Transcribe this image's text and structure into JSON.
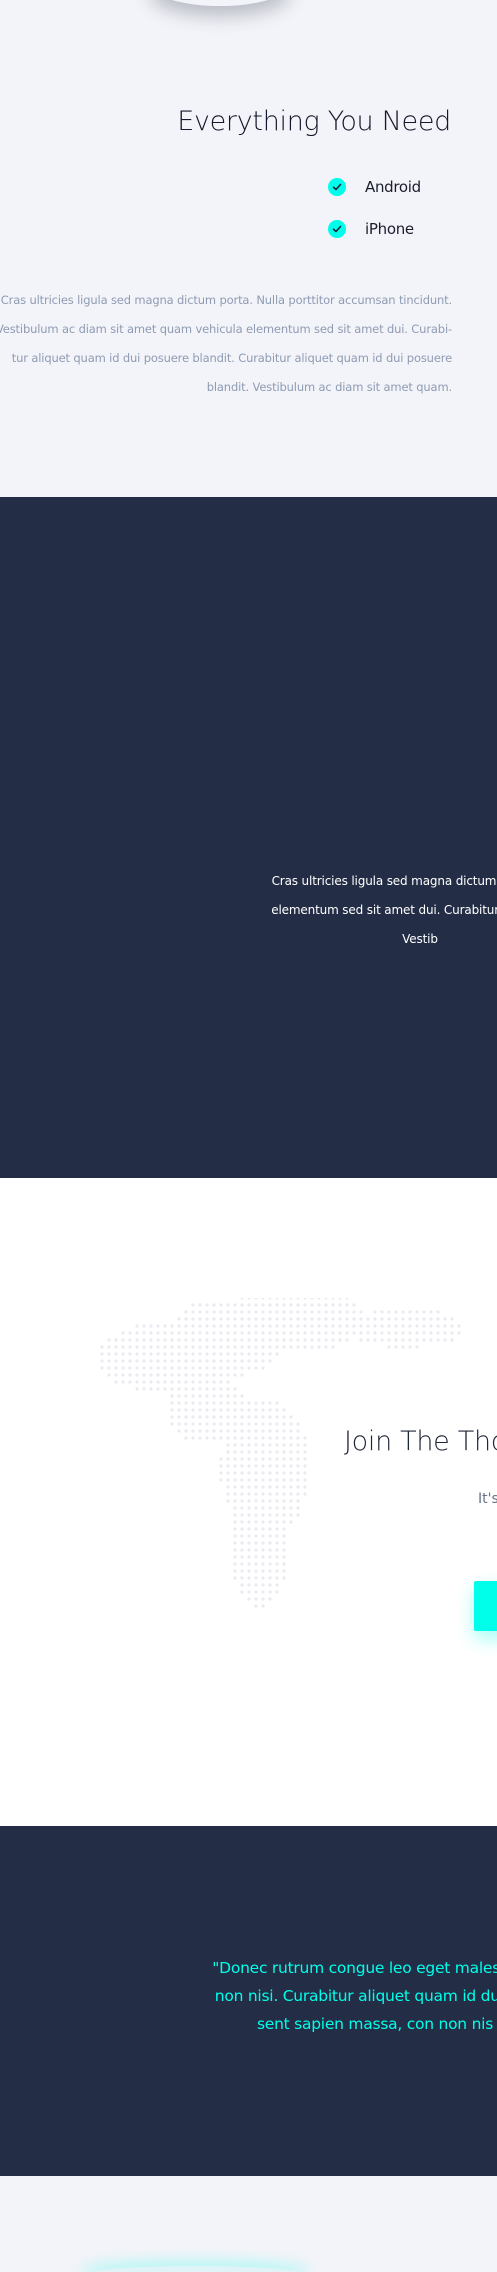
{
  "features_section": {
    "title": "Everything You Need",
    "features": [
      {
        "label": "Android",
        "icon": "check-icon"
      },
      {
        "label": "iPhone",
        "icon": "check-icon"
      }
    ],
    "paragraph_lines": [
      "Cras ultricies ligula sed magna dictum porta. Nulla porttitor accumsan tincidunt.",
      "Vestibulum ac diam sit amet quam vehicula elementum sed sit amet dui. Curabi-",
      "tur aliquet quam id dui posuere blandit. Curabitur aliquet quam id dui posuere",
      "blandit. Vestibulum ac diam sit amet quam."
    ]
  },
  "dark_section": {
    "paragraph_lines": [
      "Cras ultricies ligula sed magna dictum porta. Nulla",
      "elementum sed sit amet dui. Curabitur aliquet qua",
      "Vestib"
    ]
  },
  "join_section": {
    "title": "Join The Tho",
    "subtitle": "It's",
    "map_icon": "world-map-icon"
  },
  "quote_section": {
    "lines": [
      "\"Donec rutrum congue leo eget malesuada",
      "non nisi. Curabitur aliquet quam id dui pos",
      "sent sapien massa, con non nis"
    ]
  },
  "colors": {
    "accent": "#00ffea",
    "dark_bg": "#232d46",
    "light_bg": "#f3f4f9",
    "muted_text": "#8f9bb3"
  }
}
